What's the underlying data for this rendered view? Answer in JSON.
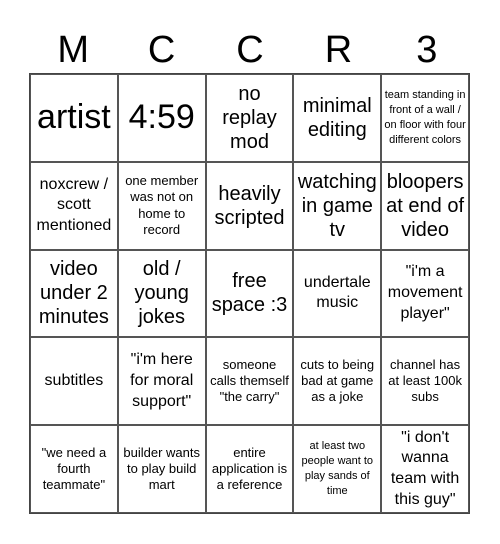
{
  "header": [
    "M",
    "C",
    "C",
    "R",
    "3"
  ],
  "cells": [
    {
      "text": "artist",
      "size": "xl"
    },
    {
      "text": "4:59",
      "size": "xl"
    },
    {
      "text": "no replay mod",
      "size": "l"
    },
    {
      "text": "minimal editing",
      "size": "l"
    },
    {
      "text": "team standing in front of a wall / on floor with four different colors",
      "size": "xs"
    },
    {
      "text": "noxcrew / scott mentioned",
      "size": "m"
    },
    {
      "text": "one member was not on home to record",
      "size": "s"
    },
    {
      "text": "heavily scripted",
      "size": "l"
    },
    {
      "text": "watching in game tv",
      "size": "l"
    },
    {
      "text": "bloopers at end of video",
      "size": "l"
    },
    {
      "text": "video under 2 minutes",
      "size": "l"
    },
    {
      "text": "old / young jokes",
      "size": "l"
    },
    {
      "text": "free space :3",
      "size": "l"
    },
    {
      "text": "undertale music",
      "size": "m"
    },
    {
      "text": "\"i'm a movement player\"",
      "size": "m"
    },
    {
      "text": "subtitles",
      "size": "m"
    },
    {
      "text": "\"i'm here for moral support\"",
      "size": "m"
    },
    {
      "text": "someone calls themself \"the carry\"",
      "size": "s"
    },
    {
      "text": "cuts to being bad at game as a joke",
      "size": "s"
    },
    {
      "text": "channel has at least 100k subs",
      "size": "s"
    },
    {
      "text": "\"we need a fourth teammate\"",
      "size": "s"
    },
    {
      "text": "builder wants to play build mart",
      "size": "s"
    },
    {
      "text": "entire application is a reference",
      "size": "s"
    },
    {
      "text": "at least two people want to play sands of time",
      "size": "xs"
    },
    {
      "text": "\"i don't wanna team with this guy\"",
      "size": "m"
    }
  ]
}
